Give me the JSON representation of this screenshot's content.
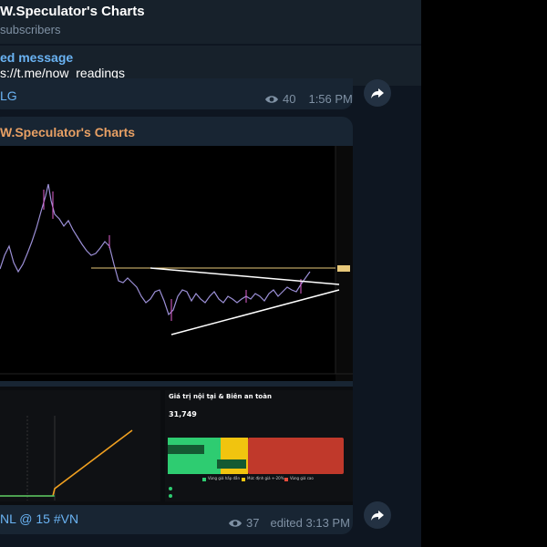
{
  "header": {
    "title": "W.Speculator's Charts",
    "subtitle": "subscribers"
  },
  "pinned": {
    "title": "ed message",
    "text": "s://t.me/now_readings"
  },
  "message1": {
    "tag": "LG",
    "views": "40",
    "time": "1:56 PM"
  },
  "message2": {
    "forwarded_from": "W.Speculator's Charts",
    "caption_prefix": "NL @ 15 ",
    "caption_tag": "#VN",
    "views": "37",
    "time": "edited 3:13 PM"
  },
  "dashboard": {
    "panel_title": "Giá trị nội tại & Biên an toàn",
    "value": "31,749",
    "legend": [
      "Vùng giá hấp dẫn",
      "Mức định giá +-20%",
      "Vùng giá cao"
    ],
    "colors": [
      "#2ecc71",
      "#f1c40f",
      "#e74c3c"
    ]
  },
  "colors": {
    "link": "#6ab3f3",
    "forward_name": "#e8a064",
    "bubble": "#182533",
    "meta": "#7f91a4"
  },
  "icons": {
    "views": "eye-icon",
    "share": "share-arrow-icon"
  }
}
